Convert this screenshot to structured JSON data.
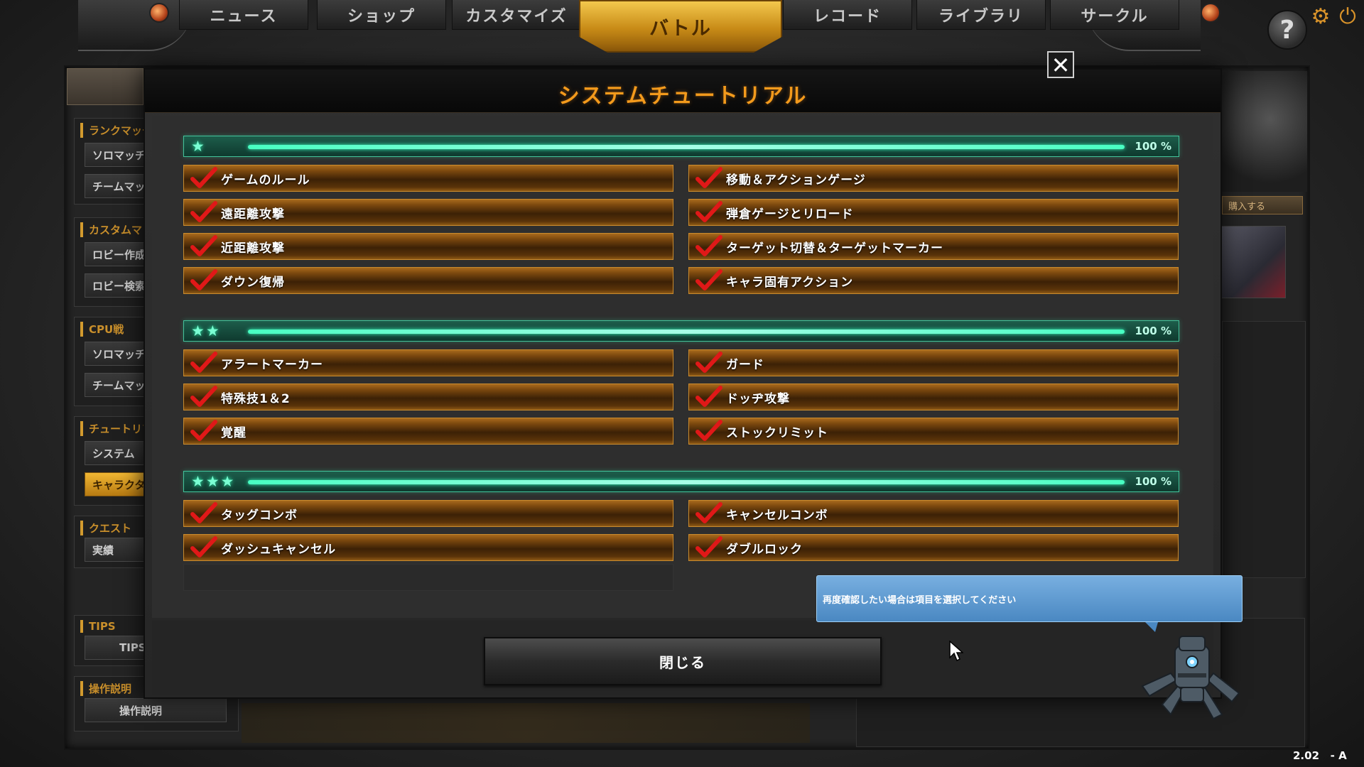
{
  "nav": {
    "tabs": [
      {
        "label": "ニュース",
        "active": false
      },
      {
        "label": "ショップ",
        "active": false
      },
      {
        "label": "カスタマイズ",
        "active": false
      },
      {
        "label": "バトル",
        "active": true
      },
      {
        "label": "レコード",
        "active": false
      },
      {
        "label": "ライブラリ",
        "active": false
      },
      {
        "label": "サークル",
        "active": false
      }
    ],
    "help_glyph": "?"
  },
  "sidebar": {
    "groups": [
      {
        "title": "ランクマッチ",
        "items": [
          "ソロマッチ",
          "チームマッチ"
        ]
      },
      {
        "title": "カスタムマッチ",
        "items": [
          "ロビー作成",
          "ロビー検索"
        ]
      },
      {
        "title": "CPU戦",
        "items": [
          "ソロマッチ",
          "チームマッチ"
        ]
      },
      {
        "title": "チュートリアル",
        "items": [
          "システム",
          "キャラクター"
        ]
      },
      {
        "title": "クエスト",
        "items": [
          "実績"
        ]
      },
      {
        "title": "TIPS",
        "items": [
          "TIPS"
        ]
      },
      {
        "title": "操作説明",
        "items": [
          "操作説明"
        ]
      }
    ]
  },
  "right_panel": {
    "buy_label": "購入する"
  },
  "modal": {
    "title": "システムチュートリアル",
    "close_glyph": "✕",
    "close_button_label": "閉じる",
    "sections": [
      {
        "stars": "★",
        "progress_percent": 100,
        "progress_label": "100 %",
        "items": [
          "ゲームのルール",
          "移動＆アクションゲージ",
          "遠距離攻撃",
          "弾倉ゲージとリロード",
          "近距離攻撃",
          "ターゲット切替＆ターゲットマーカー",
          "ダウン復帰",
          "キャラ固有アクション"
        ]
      },
      {
        "stars": "★★",
        "progress_percent": 100,
        "progress_label": "100 %",
        "items": [
          "アラートマーカー",
          "ガード",
          "特殊技1＆2",
          "ドッヂ攻撃",
          "覚醒",
          "ストックリミット"
        ]
      },
      {
        "stars": "★★★",
        "progress_percent": 100,
        "progress_label": "100 %",
        "items": [
          "タッグコンボ",
          "キャンセルコンボ",
          "ダッシュキャンセル",
          "ダブルロック"
        ]
      }
    ]
  },
  "tooltip": {
    "text": "再度確認したい場合は項目を選択してください"
  },
  "version": "2.02   - A",
  "colors": {
    "accent_orange": "#f39a1c",
    "progress_green": "#48ffc2",
    "check_red": "#e01818",
    "tooltip_blue": "#4a88c2"
  }
}
